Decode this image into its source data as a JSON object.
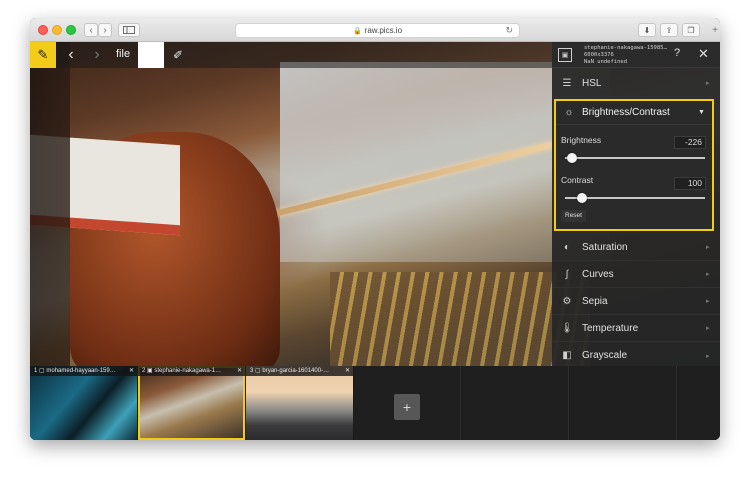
{
  "browser": {
    "url": "raw.pics.io",
    "back_glyph": "‹",
    "forward_glyph": "›",
    "reload_glyph": "↻"
  },
  "toolbar": {
    "file_label": "file"
  },
  "panel": {
    "meta_line1": "stephanie-nakagawa-15985…",
    "meta_line2": "6000x3376",
    "meta_line3": "NaN undefined",
    "help_label": "?",
    "items_top": [
      {
        "label": "HSL",
        "icon": "sliders-icon"
      }
    ],
    "brightness_contrast": {
      "title": "Brightness/Contrast",
      "brightness_label": "Brightness",
      "brightness_value": "-226",
      "brightness_fraction": 0.05,
      "contrast_label": "Contrast",
      "contrast_value": "100",
      "contrast_fraction": 0.12,
      "reset_label": "Reset"
    },
    "items_bottom": [
      {
        "label": "Saturation",
        "icon": "saturation-icon"
      },
      {
        "label": "Curves",
        "icon": "curves-icon"
      },
      {
        "label": "Sepia",
        "icon": "sepia-icon"
      },
      {
        "label": "Temperature",
        "icon": "thermometer-icon"
      },
      {
        "label": "Grayscale",
        "icon": "grayscale-icon"
      }
    ]
  },
  "filmstrip": {
    "thumbs": [
      {
        "index": "1",
        "name": "mohamed-hayyaan-159…"
      },
      {
        "index": "2",
        "name": "stephanie-nakagawa-1…"
      },
      {
        "index": "3",
        "name": "bryan-garcia-1601400-…"
      }
    ],
    "add_label": "+"
  },
  "colors": {
    "accent": "#f3cc19",
    "panel_bg": "#262626"
  }
}
